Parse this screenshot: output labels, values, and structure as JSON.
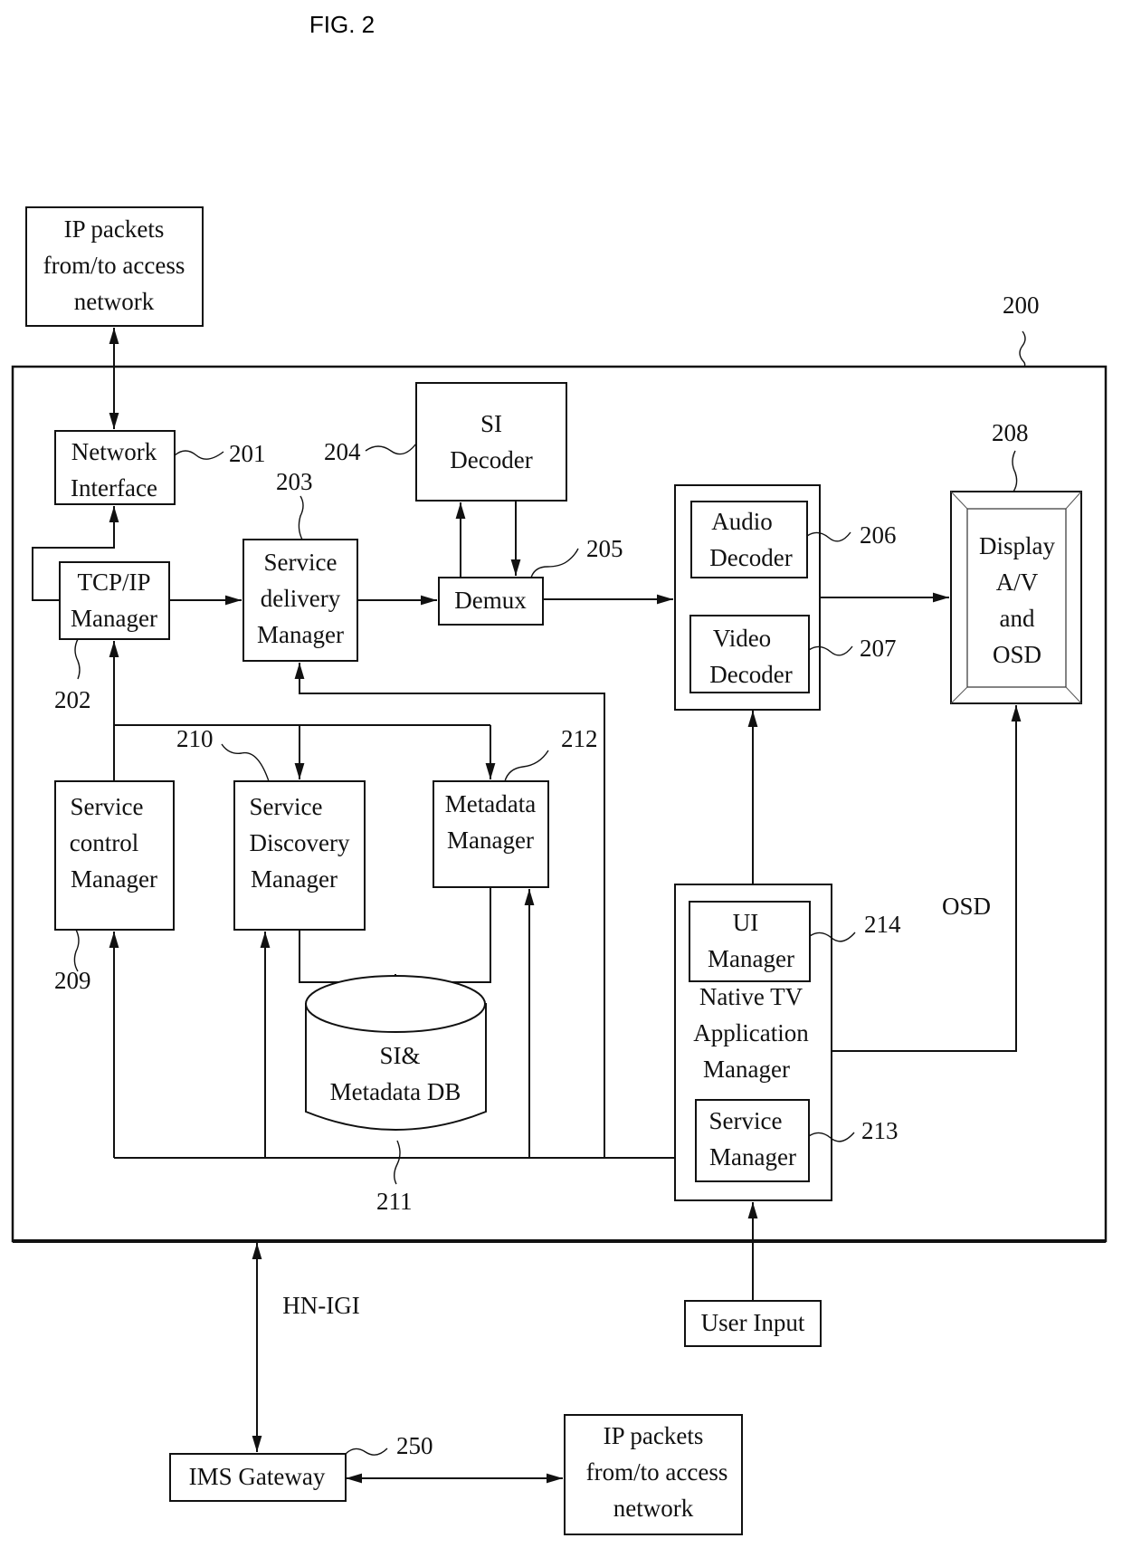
{
  "figure": {
    "title": "FIG. 2"
  },
  "system": {
    "ref": "200"
  },
  "blocks": {
    "ip_top": {
      "lines": [
        "IP packets",
        "from/to access",
        "network"
      ]
    },
    "network_interface": {
      "lines": [
        "Network",
        "Interface"
      ],
      "ref": "201"
    },
    "tcpip_manager": {
      "lines": [
        "TCP/IP",
        "Manager"
      ],
      "ref": "202"
    },
    "service_delivery": {
      "lines": [
        "Service",
        "delivery",
        "Manager"
      ],
      "ref": "203"
    },
    "si_decoder": {
      "lines": [
        "SI",
        "Decoder"
      ],
      "ref": "204"
    },
    "demux": {
      "lines": [
        "Demux"
      ],
      "ref": "205"
    },
    "audio_decoder": {
      "lines": [
        "Audio",
        "Decoder"
      ],
      "ref": "206"
    },
    "video_decoder": {
      "lines": [
        "Video",
        "Decoder"
      ],
      "ref": "207"
    },
    "display": {
      "lines": [
        "Display",
        "A/V",
        "and",
        "OSD"
      ],
      "ref": "208"
    },
    "service_control": {
      "lines": [
        "Service",
        "control",
        "Manager"
      ],
      "ref": "209"
    },
    "service_discovery": {
      "lines": [
        "Service",
        "Discovery",
        "Manager"
      ],
      "ref": "210"
    },
    "metadata_db": {
      "lines": [
        "SI&",
        "Metadata DB"
      ],
      "ref": "211"
    },
    "metadata_manager": {
      "lines": [
        "Metadata",
        "Manager"
      ],
      "ref": "212"
    },
    "service_manager": {
      "lines": [
        "Service",
        "Manager"
      ],
      "ref": "213"
    },
    "ui_manager": {
      "lines": [
        "UI",
        "Manager"
      ],
      "ref": "214"
    },
    "native_tv": {
      "lines": [
        "Native TV",
        "Application",
        "Manager"
      ]
    },
    "user_input": {
      "lines": [
        "User Input"
      ]
    },
    "ims_gateway": {
      "lines": [
        "IMS Gateway"
      ],
      "ref": "250"
    },
    "ip_bottom": {
      "lines": [
        "IP packets",
        "from/to access",
        "network"
      ]
    }
  },
  "labels": {
    "osd": "OSD",
    "hn_igi": "HN-IGI"
  }
}
